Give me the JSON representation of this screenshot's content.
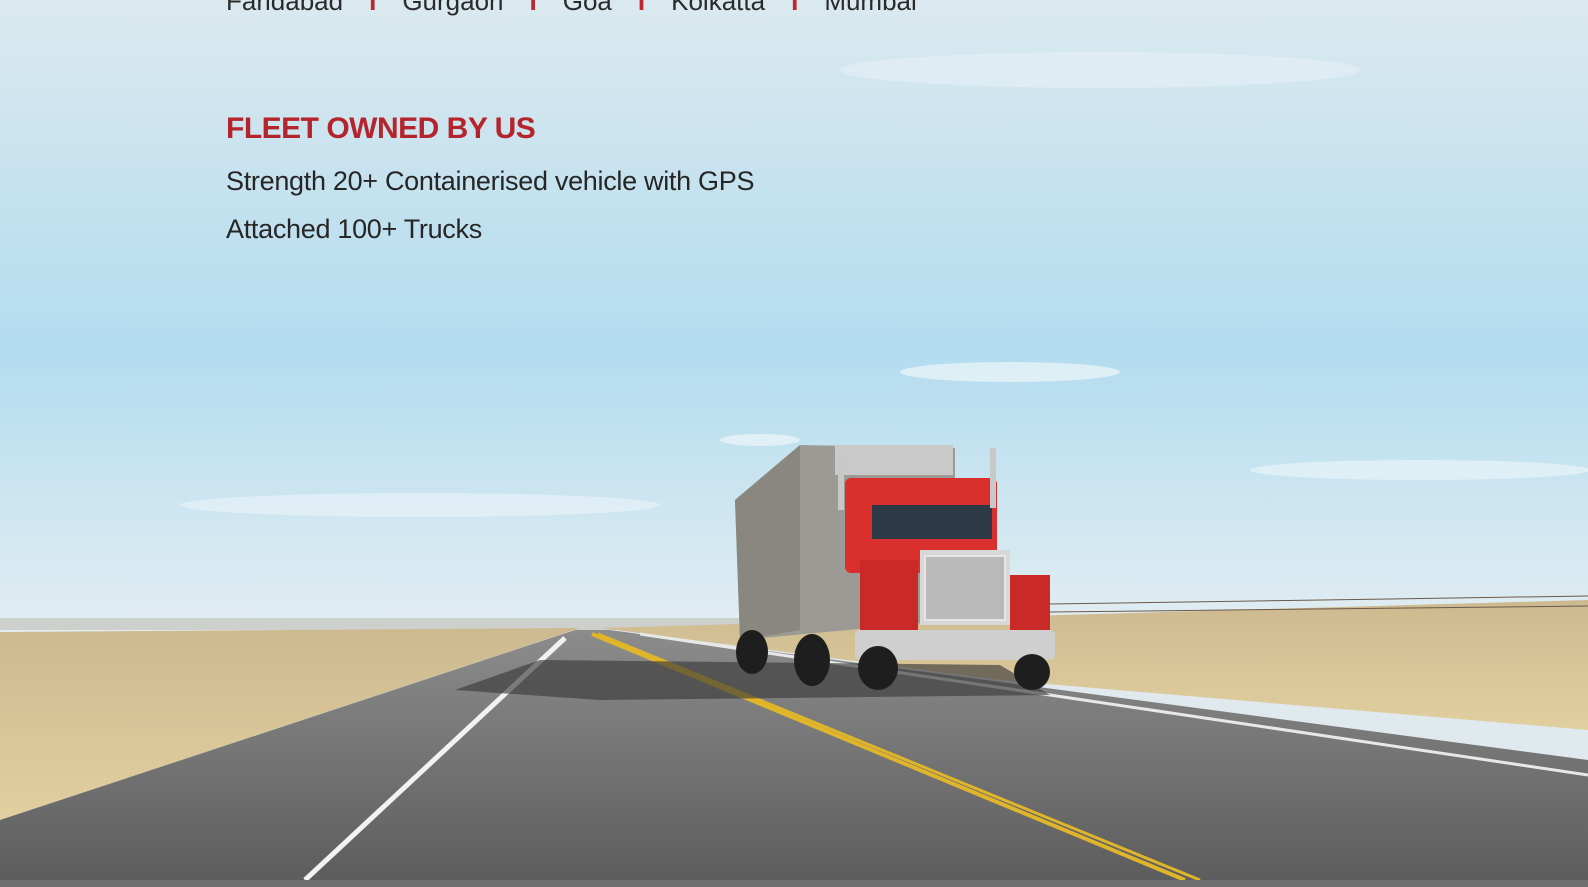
{
  "cities": [
    "Faridabad",
    "Gurgaon",
    "Goa",
    "Kolkatta",
    "Mumbai"
  ],
  "separator": "I",
  "fleet": {
    "heading": "FLEET OWNED BY US",
    "lines": [
      "Strength 20+ Containerised vehicle with GPS",
      "Attached 100+ Trucks"
    ]
  },
  "colors": {
    "accent": "#b5232b",
    "text": "#262626",
    "sky_top": "#d4e8f0",
    "sky_bottom": "#a8d8ec",
    "field": "#d9c08a",
    "road": "#6a6a6a",
    "truck_cab": "#d9302e"
  }
}
